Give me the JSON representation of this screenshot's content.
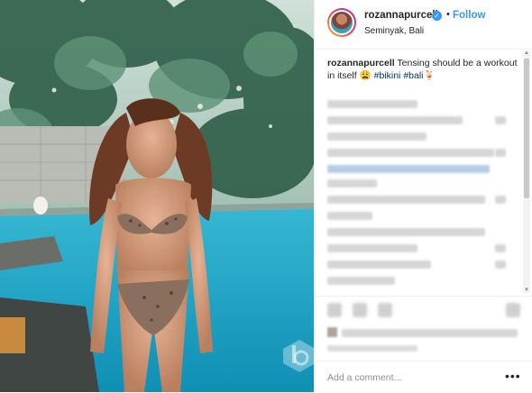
{
  "post": {
    "username": "rozannapurcell",
    "follow_label": "Follow",
    "location": "Seminyak, Bali",
    "dot": "•",
    "verified_glyph": "✓",
    "verified_icon": "verified-badge-icon",
    "caption": {
      "user": "rozannapurcell",
      "text": " Tensing should be a workout in itself ",
      "emoji": "😩",
      "tags": [
        "#bikini",
        "#bali"
      ],
      "tail_emoji": "🍹"
    },
    "comment_placeholder": "Add a comment...",
    "more_label": "•••"
  },
  "colors": {
    "accent": "#3897f0",
    "text": "#262626",
    "muted": "#8e8e8e",
    "hashtag": "#003569",
    "pool": "#1fa8c9"
  },
  "icons": {
    "like": "heart-icon",
    "comment": "comment-icon",
    "share": "share-icon",
    "save": "bookmark-icon",
    "more": "more-options-icon",
    "scroll_up": "▲",
    "scroll_down": "▼"
  }
}
